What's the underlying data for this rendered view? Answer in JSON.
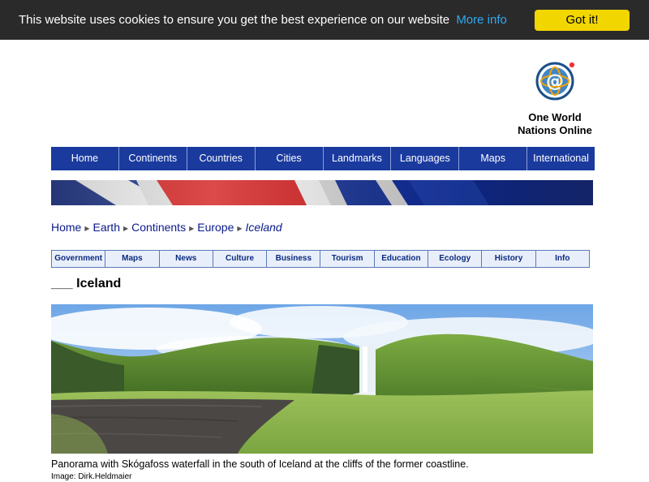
{
  "cookie": {
    "message": "This website uses cookies to ensure you get the best experience on our website",
    "more_info": "More info",
    "button": "Got it!"
  },
  "logo": {
    "line1": "One World",
    "line2": "Nations Online",
    "icon": "at-globe-icon"
  },
  "main_nav": {
    "items": [
      "Home",
      "Continents",
      "Countries",
      "Cities",
      "Landmarks",
      "Languages",
      "Maps",
      "International"
    ]
  },
  "breadcrumb": {
    "items": [
      "Home",
      "Earth",
      "Continents",
      "Europe"
    ],
    "current": "Iceland"
  },
  "sub_nav": {
    "items": [
      "Government",
      "Maps",
      "News",
      "Culture",
      "Business",
      "Tourism",
      "Education",
      "Ecology",
      "History",
      "Info"
    ]
  },
  "page": {
    "title_prefix": "___",
    "title": "Iceland"
  },
  "image": {
    "caption": "Panorama with Skógafoss waterfall in the south of Iceland at the cliffs of the former coastline.",
    "credit": "Image: Dirk.Heldmaier"
  },
  "colors": {
    "cookie_bg": "#2b2a2a",
    "cookie_button": "#f1d600",
    "link": "#31a8f0",
    "nav_bg": "#1a3a9e",
    "subnav_bg": "#e9effa"
  }
}
